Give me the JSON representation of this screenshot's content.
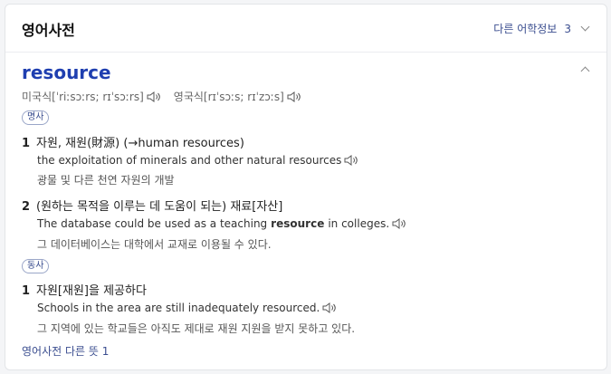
{
  "header": {
    "title": "영어사전",
    "more_label": "다른 어학정보",
    "more_count": "3"
  },
  "entry": {
    "word": "resource",
    "pron_us_label": "미국식",
    "pron_us": "[ˈriːsɔːrs; rɪˈsɔːrs]",
    "pron_uk_label": "영국식",
    "pron_uk": "[rɪˈsɔːs; rɪˈzɔːs]"
  },
  "noun": {
    "pos": "명사",
    "senses": [
      {
        "num": "1",
        "meaning": "자원, 재원(財源) (→human resources)",
        "example": "the exploitation of minerals and other natural resources",
        "translation": "광물 및 다른 천연 자원의 개발"
      },
      {
        "num": "2",
        "meaning": "(원하는 목적을 이루는 데 도움이 되는) 재료[자산]",
        "example_pre": "The database could be used as a teaching",
        "example_bold": "resource",
        "example_post": "in colleges.",
        "translation": "그 데이터베이스는 대학에서 교재로 이용될 수 있다."
      }
    ]
  },
  "verb": {
    "pos": "동사",
    "senses": [
      {
        "num": "1",
        "meaning": "자원[재원]을 제공하다",
        "example": "Schools in the area are still inadequately resourced.",
        "translation": "그 지역에 있는 학교들은 아직도 제대로 재원 지원을 받지 못하고 있다."
      }
    ]
  },
  "footer": {
    "more_meanings": "영어사전 다른 뜻 1"
  },
  "icons": {
    "speaker": "speaker-icon",
    "chevron_down": "chevron-down-icon",
    "chevron_up": "chevron-up-icon"
  }
}
